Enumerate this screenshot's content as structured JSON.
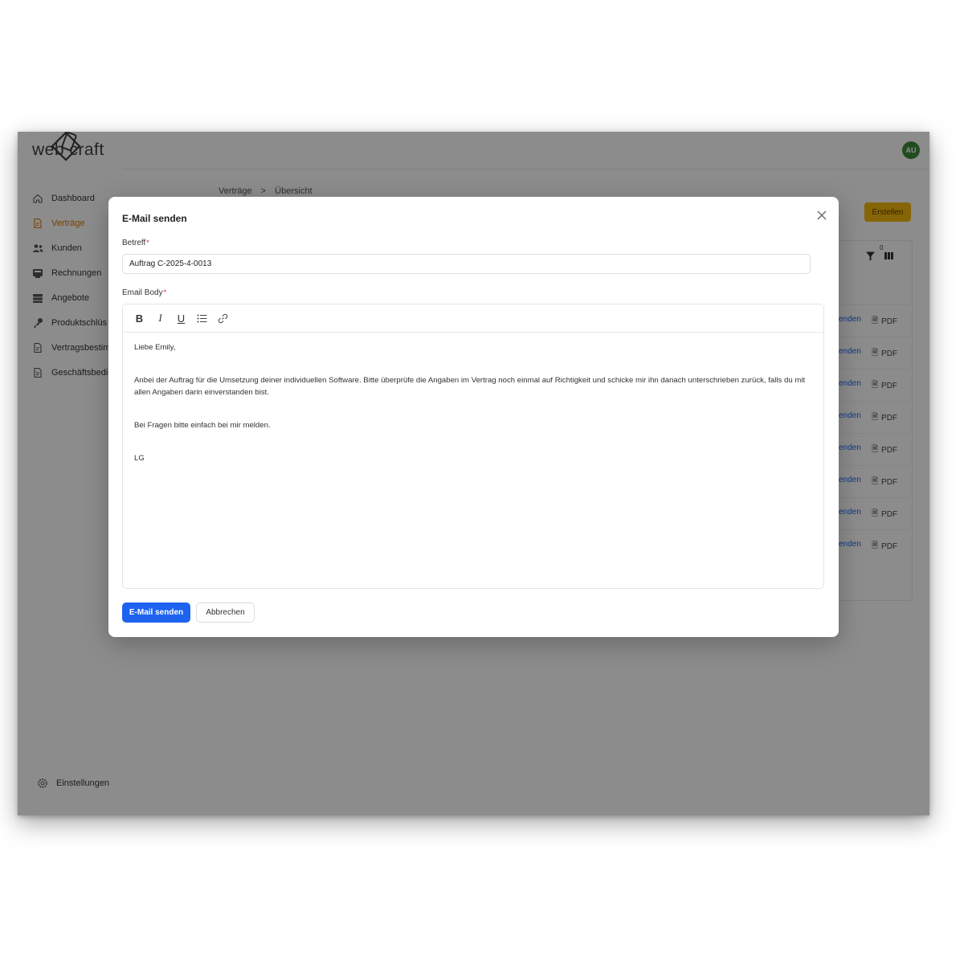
{
  "app": {
    "logo_text": "web craft",
    "avatar_initials": "AU"
  },
  "sidebar": {
    "items": [
      {
        "label": "Dashboard",
        "icon": "home-icon",
        "active": false
      },
      {
        "label": "Verträge",
        "icon": "document-icon",
        "active": true
      },
      {
        "label": "Kunden",
        "icon": "users-icon",
        "active": false
      },
      {
        "label": "Rechnungen",
        "icon": "invoice-icon",
        "active": false
      },
      {
        "label": "Angebote",
        "icon": "stack-icon",
        "active": false
      },
      {
        "label": "Produktschlüs",
        "icon": "key-icon",
        "active": false
      },
      {
        "label": "Vertragsbestim",
        "icon": "document-icon",
        "active": false
      },
      {
        "label": "Geschäftsbedi",
        "icon": "document-icon",
        "active": false
      }
    ],
    "settings_label": "Einstellungen"
  },
  "breadcrumb": [
    "Verträge",
    ">",
    "Übersicht"
  ],
  "header": {
    "create_label": "Erstellen",
    "filter_count": "0"
  },
  "table": {
    "rows": [
      {
        "send": "enden",
        "pdf": "PDF"
      },
      {
        "send": "enden",
        "pdf": "PDF"
      },
      {
        "send": "enden",
        "pdf": "PDF"
      },
      {
        "send": "enden",
        "pdf": "PDF"
      },
      {
        "send": "enden",
        "pdf": "PDF"
      },
      {
        "send": "enden",
        "pdf": "PDF"
      },
      {
        "send": "enden",
        "pdf": "PDF"
      },
      {
        "send": "enden",
        "pdf": "PDF"
      }
    ]
  },
  "modal": {
    "title": "E-Mail senden",
    "subject_label": "Betreff",
    "subject_value": "Auftrag C-2025-4-0013",
    "body_label": "Email Body",
    "required_mark": "*",
    "toolbar": {
      "bold": "B",
      "italic": "I",
      "underline": "U"
    },
    "body_paragraphs": [
      "Liebe Emily,",
      "Anbei der Auftrag für die Umsetzung deiner individuellen Software. Bitte überprüfe die Angaben im Vertrag noch einmal auf Richtigkeit und schicke mir ihn danach unterschrieben zurück, falls du mit allen Angaben darin einverstanden bist.",
      "Bei Fragen bitte einfach bei mir melden.",
      "LG"
    ],
    "send_label": "E-Mail senden",
    "cancel_label": "Abbrechen"
  },
  "colors": {
    "primary": "#1e63f0",
    "accent": "#f5b80b",
    "active_nav": "#d97706",
    "avatar": "#3f8a3a",
    "link": "#2563eb"
  }
}
